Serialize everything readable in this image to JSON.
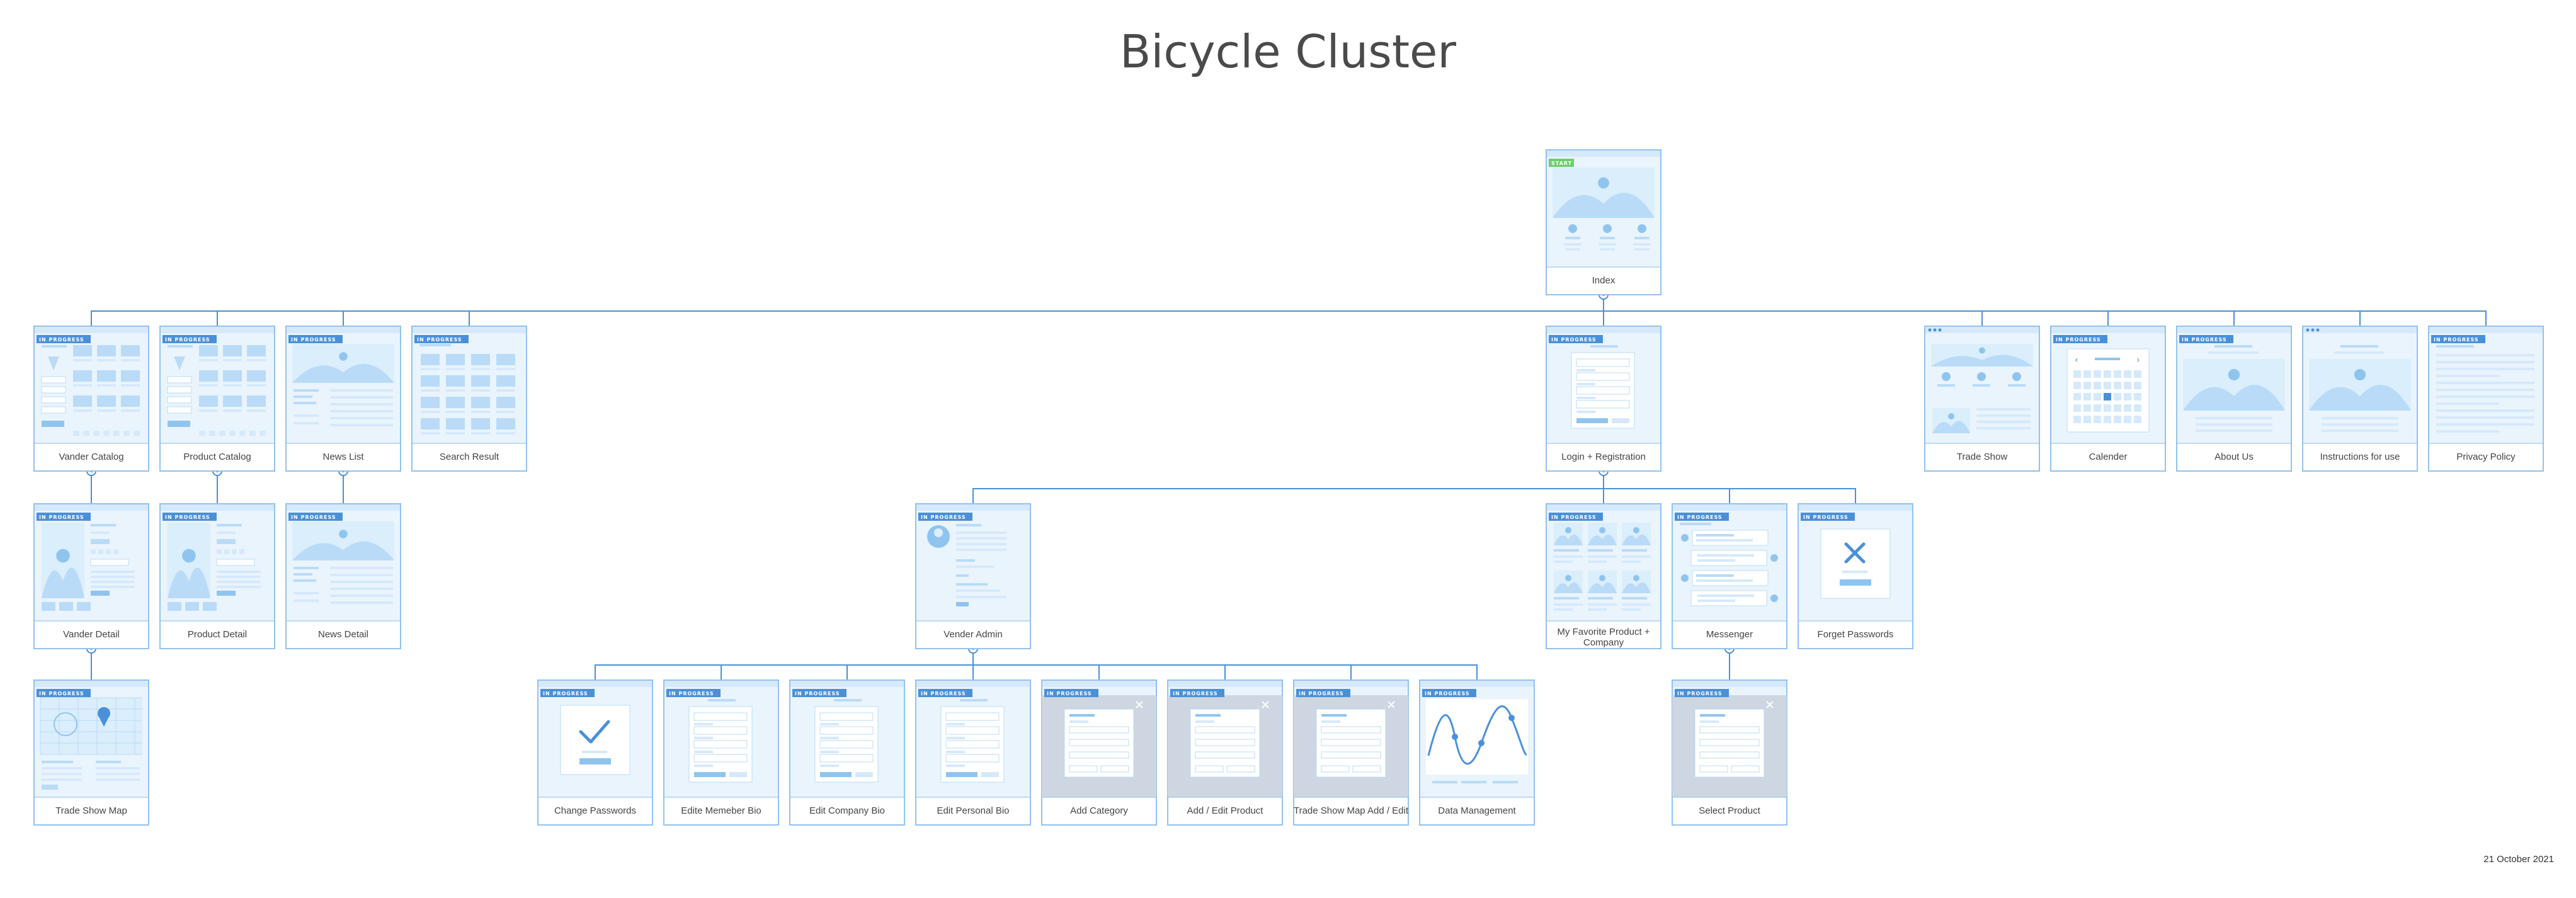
{
  "title": "Bicycle Cluster",
  "date": "21 October 2021",
  "colors": {
    "line": "#4a90d9",
    "frame": "#93c2ee",
    "fill": "#eaf4fd",
    "shape": "#b9dbf7",
    "shape_dark": "#8fc4ef",
    "badge": "#4a90d9",
    "start_badge": "#6ccf6c",
    "modal_bg": "#cdd6e1"
  },
  "badges": {
    "start": "START",
    "in_progress": "IN PROGRESS"
  },
  "nodes": [
    {
      "id": "index",
      "label": "Index",
      "thumb": "home",
      "badge": "start"
    },
    {
      "id": "vander-catalog",
      "label": "Vander Catalog",
      "thumb": "catalog",
      "badge": "in_progress"
    },
    {
      "id": "product-catalog",
      "label": "Product Catalog",
      "thumb": "catalog",
      "badge": "in_progress"
    },
    {
      "id": "news-list",
      "label": "News List",
      "thumb": "article",
      "badge": "in_progress"
    },
    {
      "id": "search-result",
      "label": "Search Result",
      "thumb": "grid",
      "badge": "in_progress"
    },
    {
      "id": "login",
      "label": "Login + Registration",
      "thumb": "form",
      "badge": "in_progress"
    },
    {
      "id": "trade-show",
      "label": "Trade Show",
      "thumb": "tradeshow",
      "badge": "dots"
    },
    {
      "id": "calender",
      "label": "Calender",
      "thumb": "calendar",
      "badge": "in_progress"
    },
    {
      "id": "about-us",
      "label": "About Us",
      "thumb": "about",
      "badge": "in_progress"
    },
    {
      "id": "instructions",
      "label": "Instructions for use",
      "thumb": "about",
      "badge": "dots"
    },
    {
      "id": "privacy",
      "label": "Privacy Policy",
      "thumb": "text",
      "badge": "in_progress"
    },
    {
      "id": "vander-detail",
      "label": "Vander Detail",
      "thumb": "detail",
      "badge": "in_progress"
    },
    {
      "id": "product-detail",
      "label": "Product Detail",
      "thumb": "detail",
      "badge": "in_progress"
    },
    {
      "id": "news-detail",
      "label": "News Detail",
      "thumb": "article",
      "badge": "in_progress"
    },
    {
      "id": "trade-show-map",
      "label": "Trade Show Map",
      "thumb": "map",
      "badge": "in_progress"
    },
    {
      "id": "vender-admin",
      "label": "Vender Admin",
      "thumb": "profile",
      "badge": "in_progress"
    },
    {
      "id": "favorite",
      "label": "My Favorite Product + Company",
      "thumb": "favorites",
      "badge": "in_progress"
    },
    {
      "id": "messenger",
      "label": "Messenger",
      "thumb": "chat",
      "badge": "in_progress"
    },
    {
      "id": "forget-passwords",
      "label": "Forget Passwords",
      "thumb": "xmark",
      "badge": "in_progress"
    },
    {
      "id": "change-passwords",
      "label": "Change Passwords",
      "thumb": "check",
      "badge": "in_progress"
    },
    {
      "id": "edit-member-bio",
      "label": "Edite Memeber Bio",
      "thumb": "form",
      "badge": "in_progress"
    },
    {
      "id": "edit-company-bio",
      "label": "Edit Company Bio",
      "thumb": "form",
      "badge": "in_progress"
    },
    {
      "id": "edit-personal-bio",
      "label": "Edit Personal Bio",
      "thumb": "form",
      "badge": "in_progress"
    },
    {
      "id": "add-category",
      "label": "Add Category",
      "thumb": "modal",
      "badge": "in_progress"
    },
    {
      "id": "add-edit-product",
      "label": "Add / Edit Product",
      "thumb": "modal",
      "badge": "in_progress"
    },
    {
      "id": "trade-show-map-add",
      "label": "Trade Show Map Add / Edit",
      "thumb": "modal",
      "badge": "in_progress"
    },
    {
      "id": "data-management",
      "label": "Data Management",
      "thumb": "chart",
      "badge": "in_progress"
    },
    {
      "id": "select-product",
      "label": "Select Product",
      "thumb": "modal",
      "badge": "in_progress"
    }
  ],
  "edges": [
    [
      "index",
      "vander-catalog"
    ],
    [
      "index",
      "product-catalog"
    ],
    [
      "index",
      "news-list"
    ],
    [
      "index",
      "search-result"
    ],
    [
      "index",
      "login"
    ],
    [
      "index",
      "trade-show"
    ],
    [
      "index",
      "calender"
    ],
    [
      "index",
      "about-us"
    ],
    [
      "index",
      "instructions"
    ],
    [
      "index",
      "privacy"
    ],
    [
      "vander-catalog",
      "vander-detail"
    ],
    [
      "product-catalog",
      "product-detail"
    ],
    [
      "news-list",
      "news-detail"
    ],
    [
      "vander-detail",
      "trade-show-map"
    ],
    [
      "login",
      "vender-admin"
    ],
    [
      "login",
      "favorite"
    ],
    [
      "login",
      "messenger"
    ],
    [
      "login",
      "forget-passwords"
    ],
    [
      "vender-admin",
      "change-passwords"
    ],
    [
      "vender-admin",
      "edit-member-bio"
    ],
    [
      "vender-admin",
      "edit-company-bio"
    ],
    [
      "vender-admin",
      "edit-personal-bio"
    ],
    [
      "vender-admin",
      "add-category"
    ],
    [
      "vender-admin",
      "add-edit-product"
    ],
    [
      "vender-admin",
      "trade-show-map-add"
    ],
    [
      "vender-admin",
      "data-management"
    ],
    [
      "messenger",
      "select-product"
    ]
  ]
}
